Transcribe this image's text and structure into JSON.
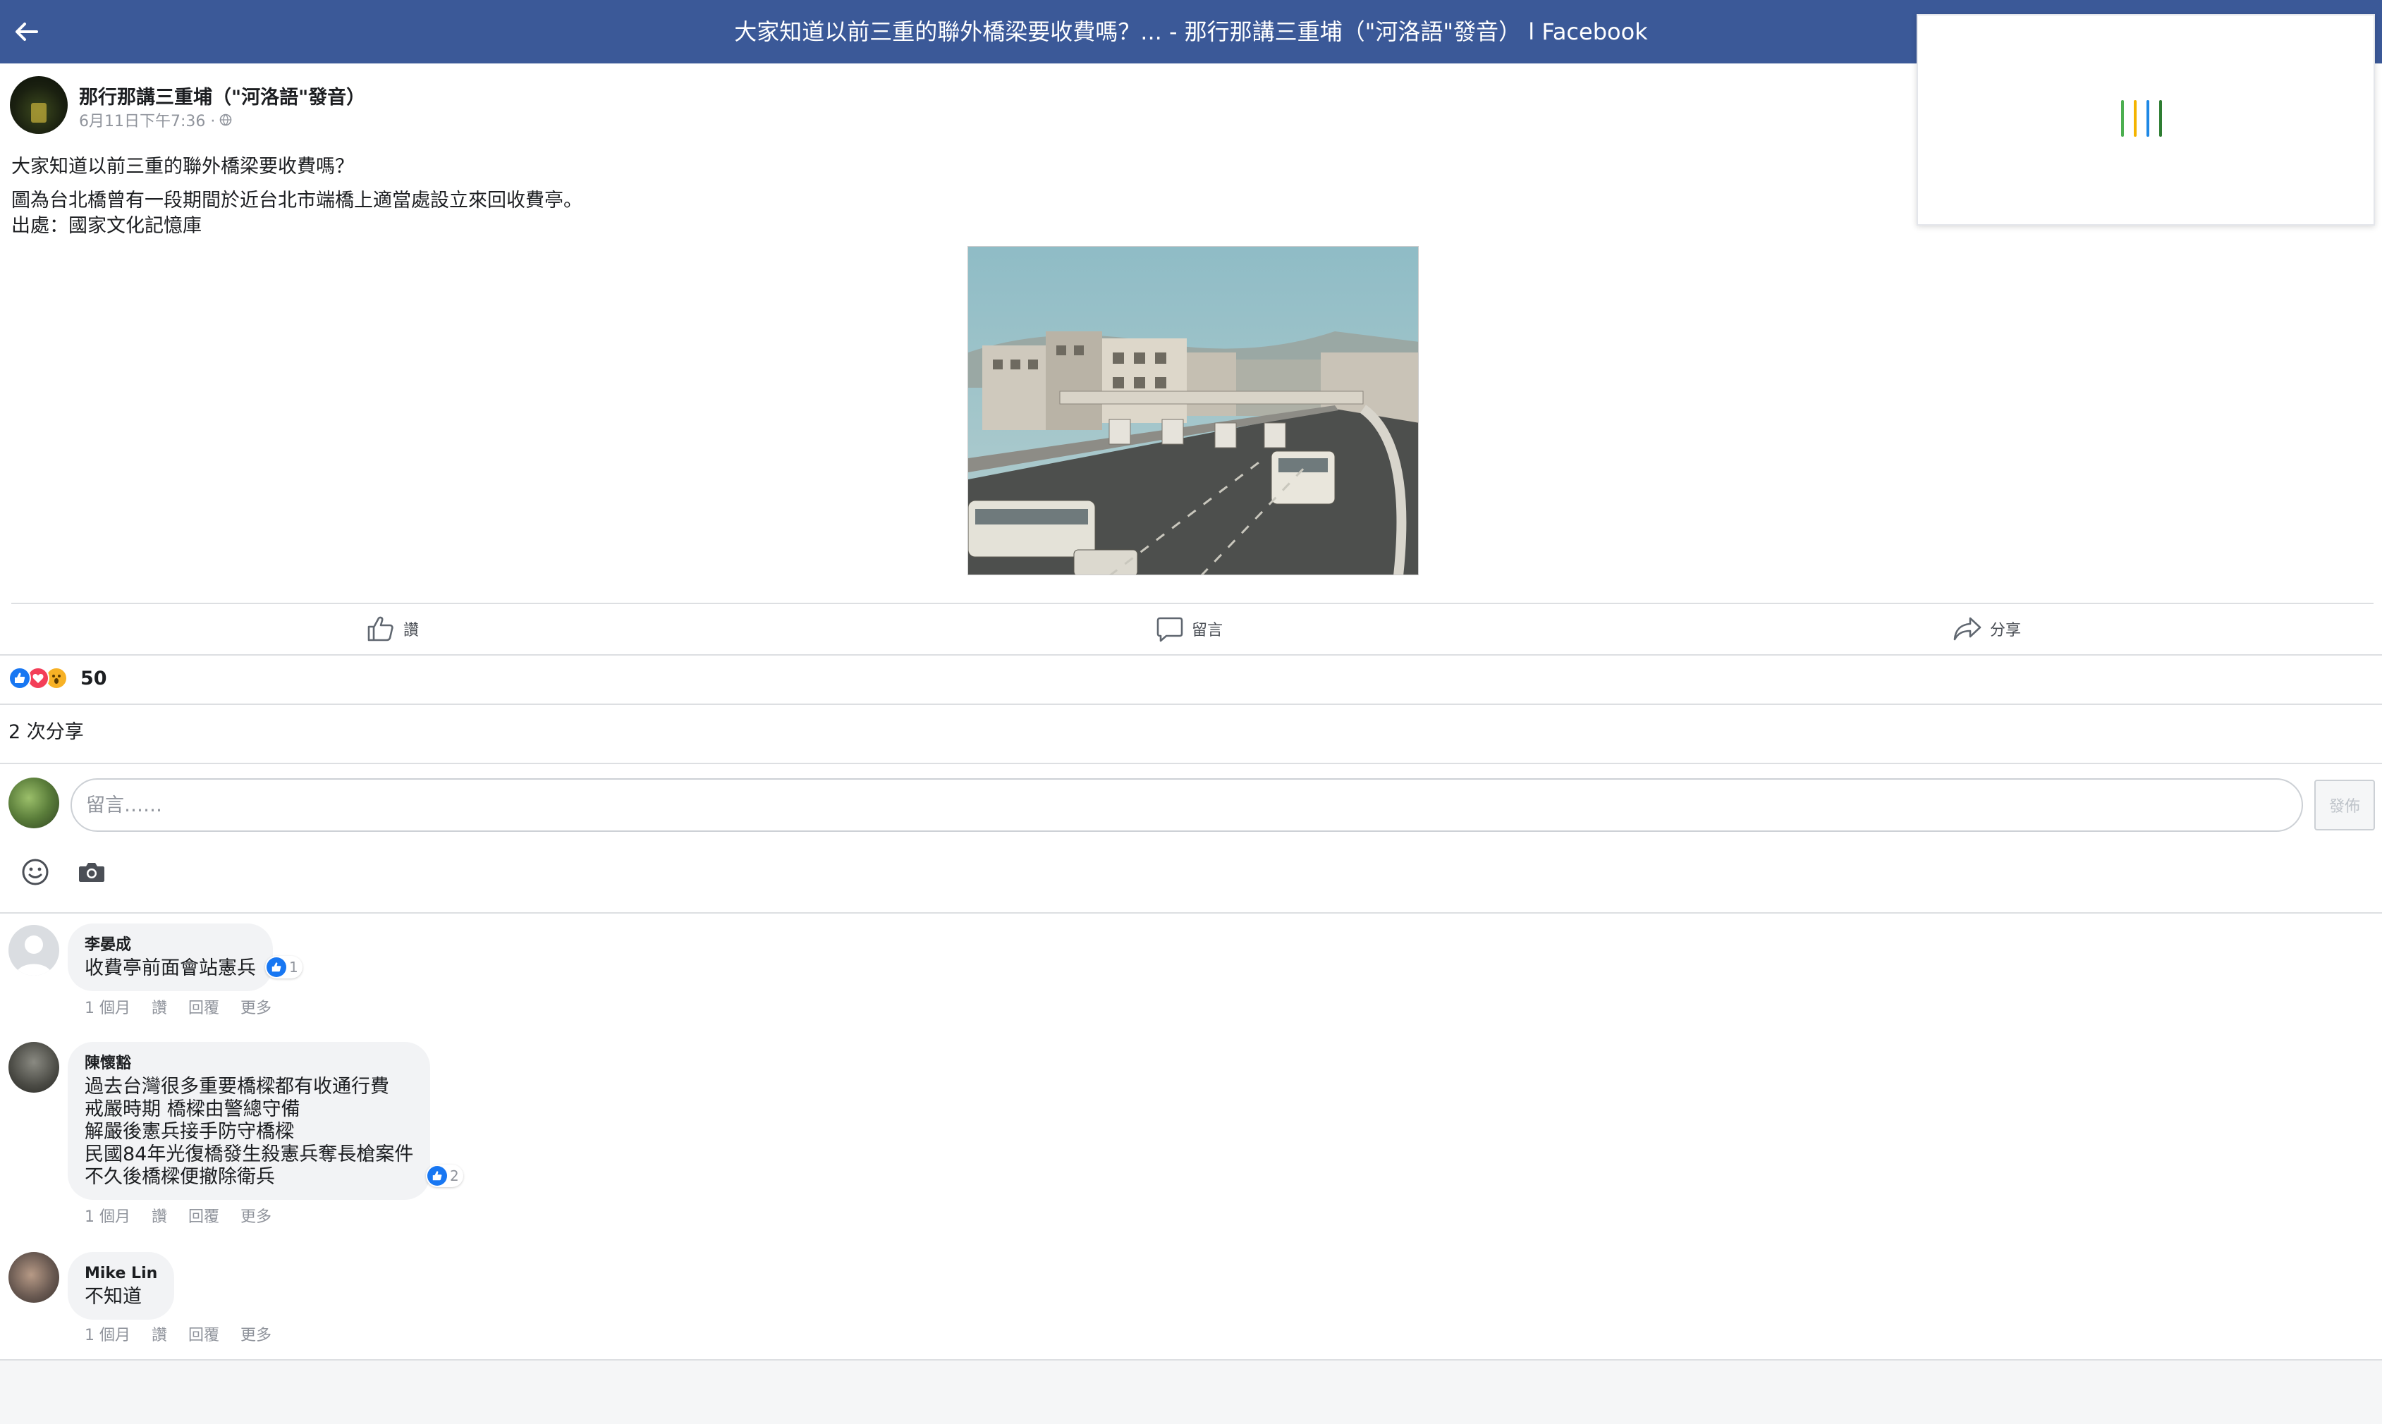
{
  "header": {
    "title": "大家知道以前三重的聯外橋梁要收費嗎？... - 那行那講三重埔（\"河洛語\"發音） l Facebook"
  },
  "loading": {
    "colors": [
      "#4caf50",
      "#f4b400",
      "#1e88e5",
      "#2e7d32"
    ]
  },
  "post": {
    "author": "那行那講三重埔（\"河洛語\"發音）",
    "timestamp": "6月11日下午7:36 ·",
    "privacy_icon": "globe-icon",
    "text_lines": [
      "大家知道以前三重的聯外橋梁要收費嗎？",
      "圖為台北橋曾有一段期間於近台北市端橋上適當處設立來回收費亭。",
      "出處：國家文化記憶庫"
    ]
  },
  "actions": {
    "like": "讚",
    "comment": "留言",
    "share": "分享"
  },
  "reactions": {
    "types": [
      "like",
      "love",
      "wow"
    ],
    "count": "50"
  },
  "shares_text": "2 次分享",
  "composer": {
    "placeholder": "留言……",
    "post_button": "發佈"
  },
  "comments": [
    {
      "name": "李晏成",
      "lines": [
        "收費亭前面會站憲兵"
      ],
      "likes": "1",
      "time": "1 個月",
      "like_label": "讚",
      "reply_label": "回覆",
      "more_label": "更多"
    },
    {
      "name": "陳懷豁",
      "lines": [
        "過去台灣很多重要橋樑都有收通行費",
        "戒嚴時期 橋樑由警總守備",
        "解嚴後憲兵接手防守橋樑",
        "民國84年光復橋發生殺憲兵奪長槍案件",
        "不久後橋樑便撤除衛兵"
      ],
      "likes": "2",
      "time": "1 個月",
      "like_label": "讚",
      "reply_label": "回覆",
      "more_label": "更多"
    },
    {
      "name": "Mike Lin",
      "lines": [
        "不知道"
      ],
      "likes": "",
      "time": "1 個月",
      "like_label": "讚",
      "reply_label": "回覆",
      "more_label": "更多"
    }
  ]
}
